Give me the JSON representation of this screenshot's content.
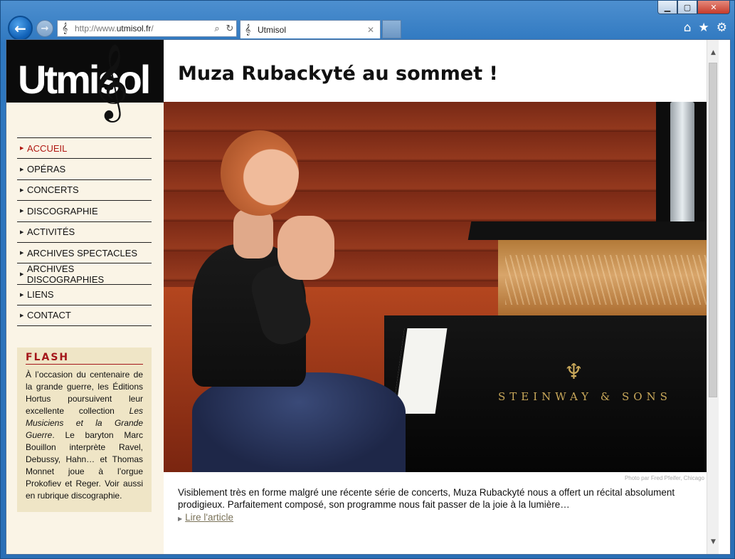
{
  "browser": {
    "url_prefix": "http://www.",
    "url_domain": "utmisol.fr",
    "url_suffix": "/",
    "tab_title": "Utmisol",
    "icons": {
      "back": "back-arrow-icon",
      "forward": "forward-arrow-icon",
      "favicon": "treble-clef-icon",
      "search": "search-icon",
      "refresh": "refresh-icon",
      "close_tab": "close-icon",
      "home": "home-icon",
      "favorites": "star-icon",
      "settings": "gear-icon",
      "minimize": "minimize-icon",
      "maximize": "maximize-icon",
      "close_window": "close-icon"
    }
  },
  "site": {
    "logo_text": "Utmisol",
    "nav": [
      {
        "label": "ACCUEIL",
        "active": true
      },
      {
        "label": "OPÉRAS",
        "active": false
      },
      {
        "label": "CONCERTS",
        "active": false
      },
      {
        "label": "DISCOGRAPHIE",
        "active": false
      },
      {
        "label": "ACTIVITÉS",
        "active": false
      },
      {
        "label": "ARCHIVES SPECTACLES",
        "active": false
      },
      {
        "label": "ARCHIVES DISCOGRAPHIES",
        "active": false
      },
      {
        "label": "LIENS",
        "active": false
      },
      {
        "label": "CONTACT",
        "active": false
      }
    ],
    "flash": {
      "title": "FLASH",
      "text_1": "À l’occasion du centenaire de la grande guerre, les Éditions Hortus poursuivent leur excellente collection ",
      "text_italic": "Les Musiciens et la Grande Guerre",
      "text_2": ". Le baryton Marc Bouillon interprète Ravel, Debussy, Hahn… et Thomas Monnet joue à l’orgue Prokofiev et Reger. Voir aussi en rubrique discographie."
    },
    "article": {
      "title": "Muza Rubackyté au sommet !",
      "photo_brand": "STEINWAY & SONS",
      "photo_credit": "Photo par Fred Pfeifer, Chicago",
      "excerpt": "Visiblement très en forme malgré une récente série de concerts, Muza Rubackyté nous a offert un récital absolument prodigieux. Parfaitement composé, son programme nous fait passer de la joie à la lumière…",
      "read_more": "Lire l'article"
    },
    "colors": {
      "accent_red": "#b01812",
      "sidebar_bg": "#faf4e6",
      "flash_bg": "#efe5c6",
      "logo_bg": "#0b0b0b"
    }
  }
}
